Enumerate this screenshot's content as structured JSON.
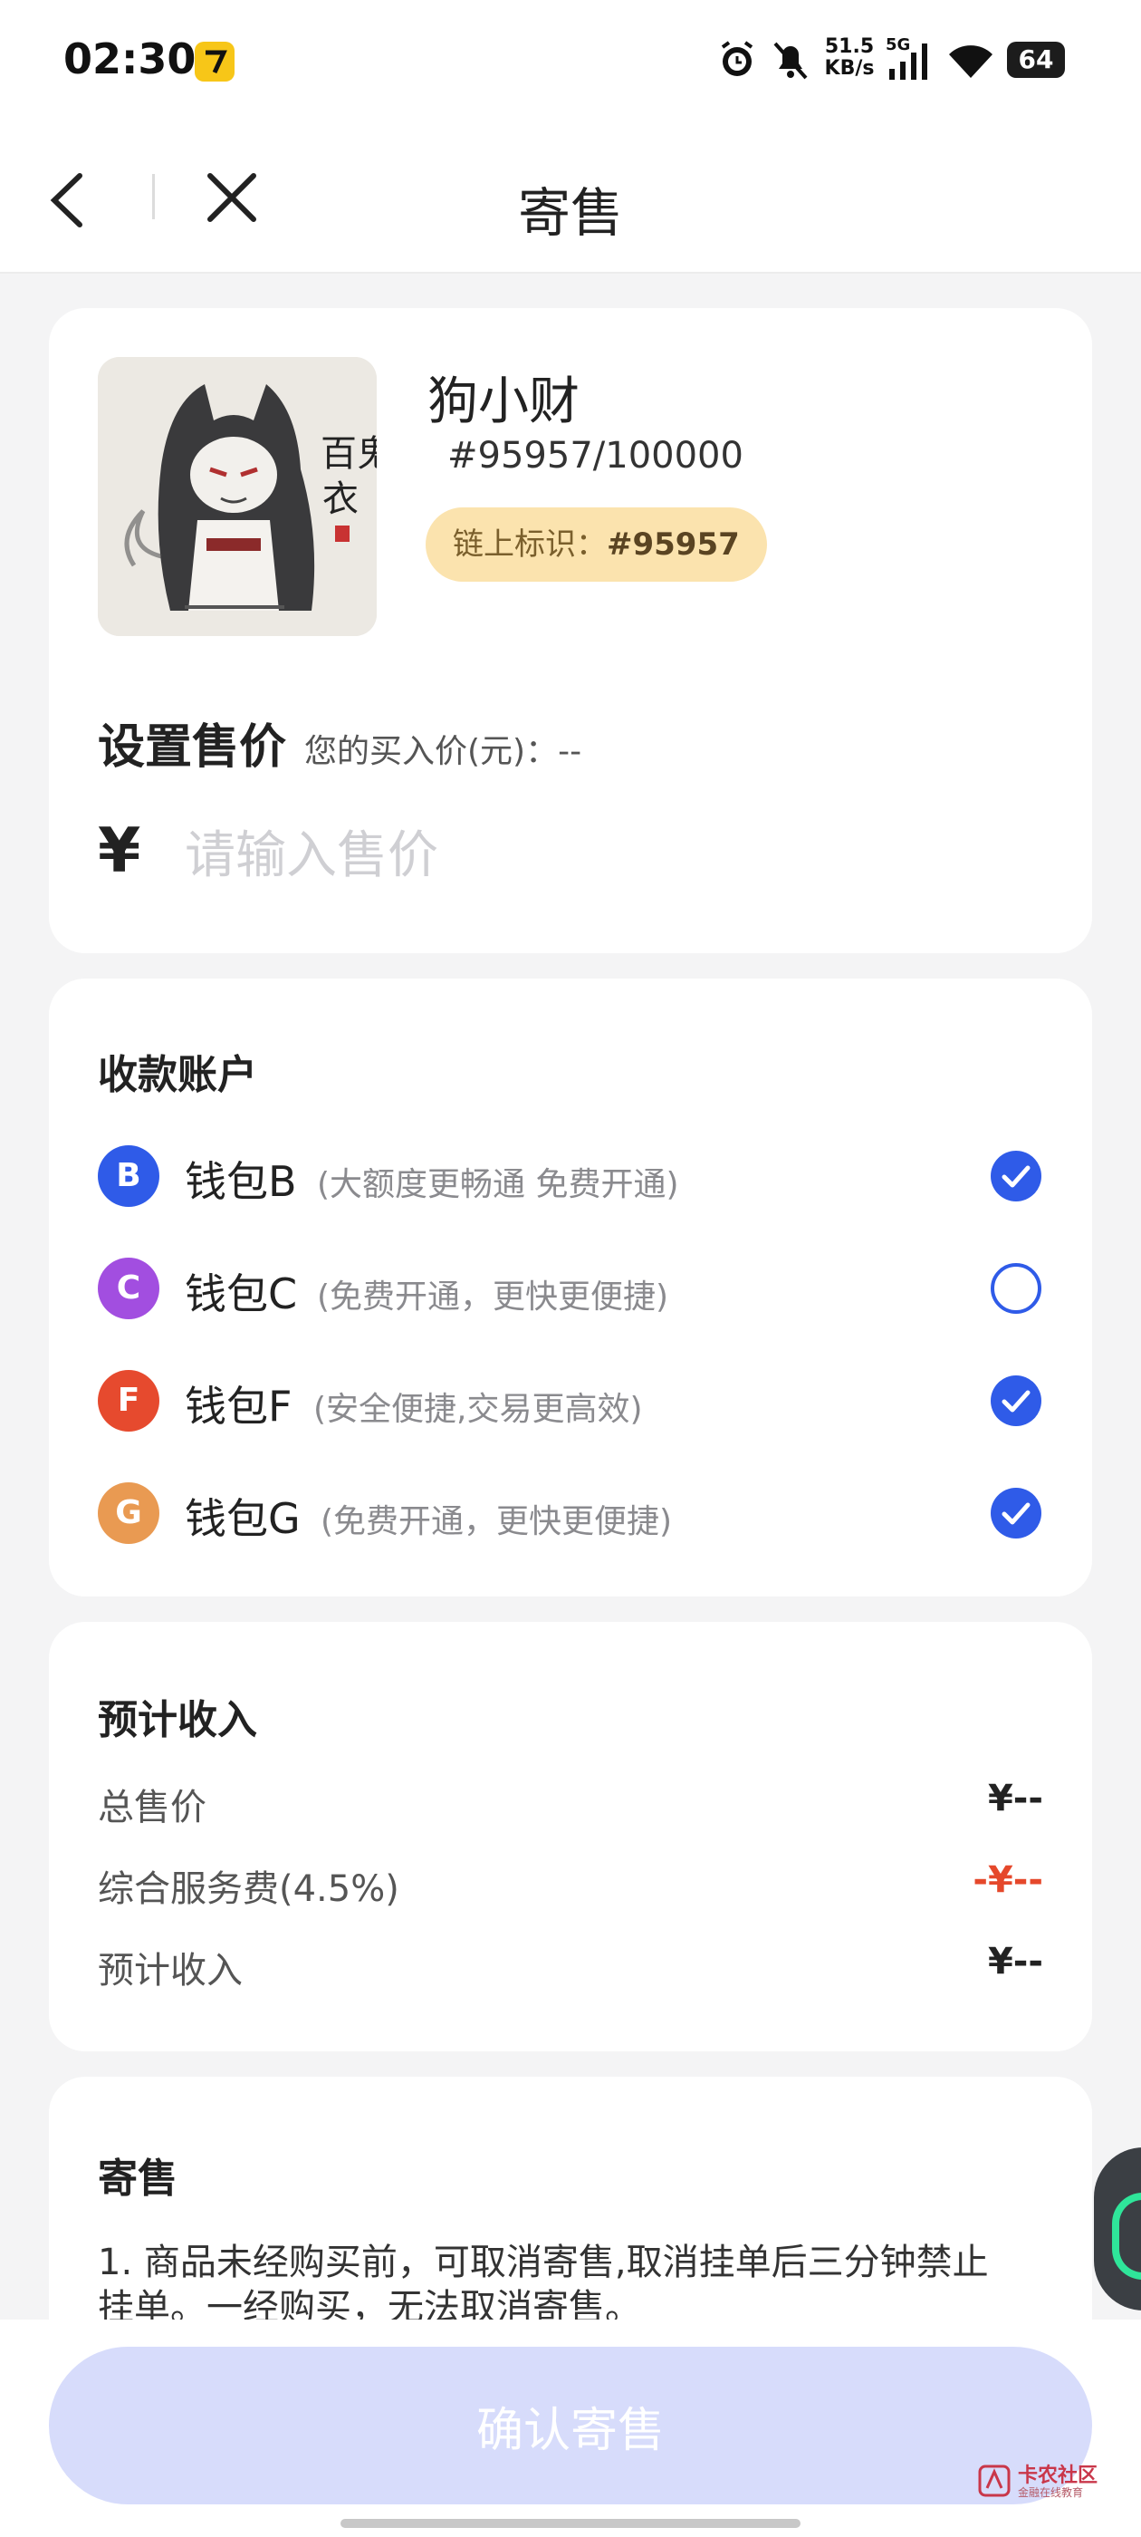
{
  "status_bar": {
    "time": "02:30",
    "net_speed_value": "51.5",
    "net_speed_unit": "KB/s",
    "network": "5G",
    "battery": "64"
  },
  "nav": {
    "title": "寄售"
  },
  "item": {
    "name": "狗小财",
    "serial": "#95957/100000",
    "chain_label": "链上标识：",
    "chain_id": "#95957",
    "image_lettering": [
      "百鬼",
      "衣"
    ]
  },
  "price": {
    "title": "设置售价",
    "buy_price_label": "您的买入价(元)：--",
    "currency": "¥",
    "placeholder": "请输入售价"
  },
  "account": {
    "title": "收款账户",
    "wallets": [
      {
        "letter": "B",
        "name": "钱包B",
        "desc": "(大额度更畅通 免费开通)",
        "color": "#2f5be8",
        "checked": true
      },
      {
        "letter": "C",
        "name": "钱包C",
        "desc": "(免费开通，更快更便捷)",
        "color": "#a24ee0",
        "checked": false
      },
      {
        "letter": "F",
        "name": "钱包F",
        "desc": "(安全便捷,交易更高效)",
        "color": "#e64a2e",
        "checked": true
      },
      {
        "letter": "G",
        "name": "钱包G",
        "desc": "(免费开通，更快更便捷)",
        "color": "#e99a52",
        "checked": true
      }
    ]
  },
  "income": {
    "title": "预计收入",
    "rows": [
      {
        "label": "总售价",
        "value": "¥--"
      },
      {
        "label": "综合服务费(4.5%)",
        "value": "-¥--"
      },
      {
        "label": "预计收入",
        "value": "¥--"
      }
    ]
  },
  "notice": {
    "title": "寄售",
    "line1": "1. 商品未经购买前，可取消寄售,取消挂单后三分钟禁止",
    "line2": "挂单。一经购买，无法取消寄售。"
  },
  "confirm_label": "确认寄售",
  "watermark": {
    "text": "卡农社区",
    "sub": "金融在线教育"
  },
  "colors": {
    "accent": "#2f5be8",
    "danger": "#e5482b",
    "button_disabled": "#d7dcfb",
    "tag_bg": "#fbe3ae"
  }
}
